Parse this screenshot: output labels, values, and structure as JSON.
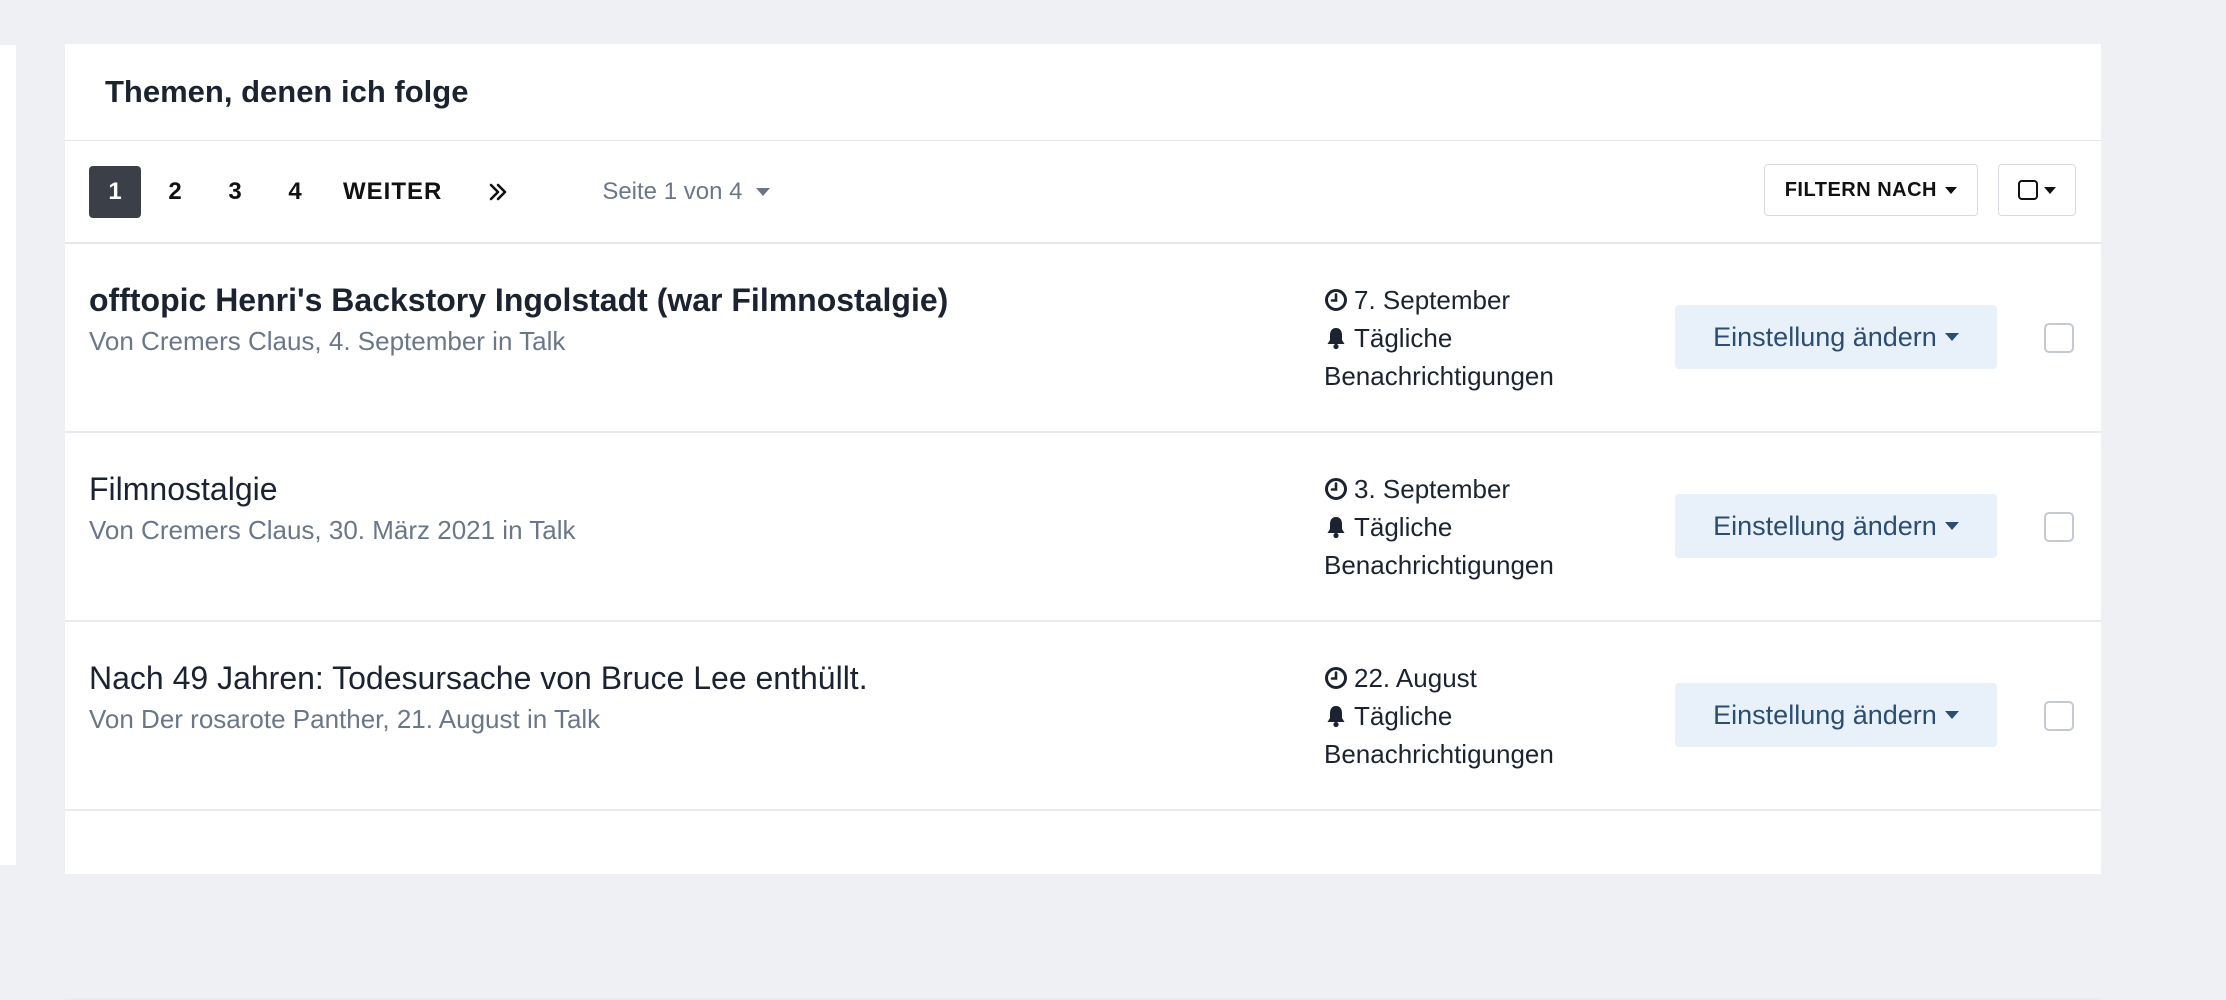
{
  "panel": {
    "title": "Themen, denen ich folge"
  },
  "pagination": {
    "pages": [
      "1",
      "2",
      "3",
      "4"
    ],
    "next_label": "WEITER",
    "last_label": "»",
    "page_info": "Seite 1 von 4"
  },
  "toolbar": {
    "filter_label": "FILTERN NACH"
  },
  "rows": [
    {
      "title": "offtopic Henri's Backstory Ingolstadt (war Filmnostalgie)",
      "meta": "Von Cremers Claus, 4. September in Talk",
      "date": "7. September",
      "notify_1": "Tägliche",
      "notify_2": "Benachrichtigungen",
      "button": "Einstellung ändern",
      "bold": true
    },
    {
      "title": "Filmnostalgie",
      "meta": "Von Cremers Claus, 30. März 2021 in Talk",
      "date": "3. September",
      "notify_1": "Tägliche",
      "notify_2": "Benachrichtigungen",
      "button": "Einstellung ändern",
      "bold": false
    },
    {
      "title": "Nach 49 Jahren: Todesursache von Bruce Lee enthüllt.",
      "meta": "Von Der rosarote Panther, 21. August in Talk",
      "date": "22. August",
      "notify_1": "Tägliche",
      "notify_2": "Benachrichtigungen",
      "button": "Einstellung ändern",
      "bold": false
    }
  ],
  "colors": {
    "active_page": "#3b4048",
    "button_bg": "#e8f1f9",
    "button_text": "#2b4d72",
    "muted_text": "#6b7789"
  },
  "icons": [
    "clock-icon",
    "bell-icon",
    "chevron-double-right-icon",
    "caret-down-icon",
    "checkbox-icon"
  ]
}
